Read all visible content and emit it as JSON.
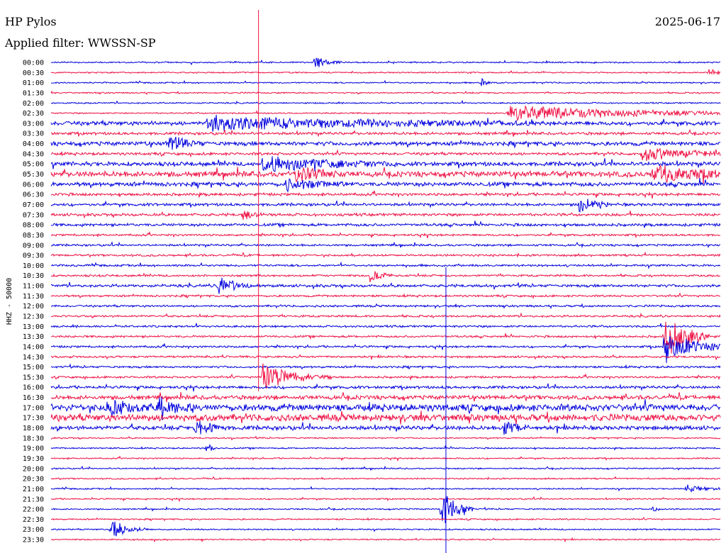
{
  "header": {
    "station": "HP Pylos",
    "date": "2025-06-17",
    "filter": "Applied filter: WWSSN-SP"
  },
  "chart_data": {
    "type": "line",
    "subtype": "helicorder",
    "ylabel": "HHZ - 50000",
    "row_labels": [
      "00:00",
      "00:30",
      "01:00",
      "01:30",
      "02:00",
      "02:30",
      "03:00",
      "03:30",
      "04:00",
      "04:30",
      "05:00",
      "05:30",
      "06:00",
      "06:30",
      "07:00",
      "07:30",
      "08:00",
      "08:30",
      "09:00",
      "09:30",
      "10:00",
      "10:30",
      "11:00",
      "11:30",
      "12:00",
      "12:30",
      "13:00",
      "13:30",
      "14:00",
      "14:30",
      "15:00",
      "15:30",
      "16:00",
      "16:30",
      "17:00",
      "17:30",
      "18:00",
      "18:30",
      "19:00",
      "19:30",
      "20:00",
      "20:30",
      "21:00",
      "21:30",
      "22:00",
      "22:30",
      "23:00",
      "23:30"
    ],
    "colors": [
      "#0000dd",
      "#ee1144"
    ],
    "noise_amplitude_rows": [
      1,
      1,
      1,
      1,
      1,
      1,
      3,
      2,
      3,
      2,
      3,
      4,
      3,
      2,
      2,
      2,
      2,
      1.5,
      1.5,
      1.5,
      1.5,
      1.5,
      2,
      1.5,
      1.5,
      1.5,
      1.5,
      1.5,
      1.5,
      1.5,
      1.5,
      1.5,
      2,
      3,
      5,
      5,
      3,
      1,
      1,
      1,
      1,
      1,
      1,
      1,
      1,
      1,
      1,
      1
    ],
    "events": [
      {
        "row": 0,
        "minute": 11.8,
        "amplitude": 10,
        "duration": 1.2
      },
      {
        "row": 1,
        "minute": 29.5,
        "amplitude": 6,
        "duration": 0.8
      },
      {
        "row": 2,
        "minute": 19.3,
        "amplitude": 8,
        "duration": 0.5
      },
      {
        "row": 5,
        "minute": 20.5,
        "amplitude": 12,
        "duration": 13
      },
      {
        "row": 6,
        "minute": 7,
        "amplitude": 10,
        "duration": 15
      },
      {
        "row": 8,
        "minute": 5.3,
        "amplitude": 14,
        "duration": 1.5
      },
      {
        "row": 9,
        "minute": 26.5,
        "amplitude": 12,
        "duration": 4
      },
      {
        "row": 10,
        "minute": 9.5,
        "amplitude": 12,
        "duration": 6
      },
      {
        "row": 11,
        "minute": 11,
        "amplitude": 12,
        "duration": 2
      },
      {
        "row": 11,
        "minute": 27,
        "amplitude": 14,
        "duration": 4
      },
      {
        "row": 12,
        "minute": 10.5,
        "amplitude": 10,
        "duration": 3
      },
      {
        "row": 14,
        "minute": 23.7,
        "amplitude": 14,
        "duration": 1.3
      },
      {
        "row": 15,
        "minute": 8.6,
        "amplitude": 8,
        "duration": 1
      },
      {
        "row": 21,
        "minute": 14.3,
        "amplitude": 12,
        "duration": 1
      },
      {
        "row": 22,
        "minute": 7.5,
        "amplitude": 16,
        "duration": 1.5
      },
      {
        "row": 27,
        "minute": 27.5,
        "amplitude": 40,
        "duration": 2
      },
      {
        "row": 28,
        "minute": 27.5,
        "amplitude": 30,
        "duration": 2.5
      },
      {
        "row": 31,
        "minute": 9.5,
        "amplitude": 20,
        "duration": 3
      },
      {
        "row": 34,
        "minute": 2.5,
        "amplitude": 14,
        "duration": 2
      },
      {
        "row": 34,
        "minute": 4.8,
        "amplitude": 16,
        "duration": 1.5
      },
      {
        "row": 36,
        "minute": 6.5,
        "amplitude": 12,
        "duration": 1.5
      },
      {
        "row": 36,
        "minute": 20.3,
        "amplitude": 12,
        "duration": 1.2
      },
      {
        "row": 38,
        "minute": 7,
        "amplitude": 8,
        "duration": 0.5
      },
      {
        "row": 42,
        "minute": 28.5,
        "amplitude": 6,
        "duration": 1.5
      },
      {
        "row": 44,
        "minute": 17.5,
        "amplitude": 30,
        "duration": 1.5
      },
      {
        "row": 44,
        "minute": 27,
        "amplitude": 6,
        "duration": 0.3
      },
      {
        "row": 46,
        "minute": 2.7,
        "amplitude": 18,
        "duration": 1.5
      }
    ],
    "long_spikes": [
      {
        "minute": 9.3,
        "from_row": 0,
        "to_row": 31,
        "color": "#ee1144"
      },
      {
        "minute": 17.7,
        "from_row": 21,
        "to_row": 47,
        "color": "#0000dd"
      }
    ]
  }
}
